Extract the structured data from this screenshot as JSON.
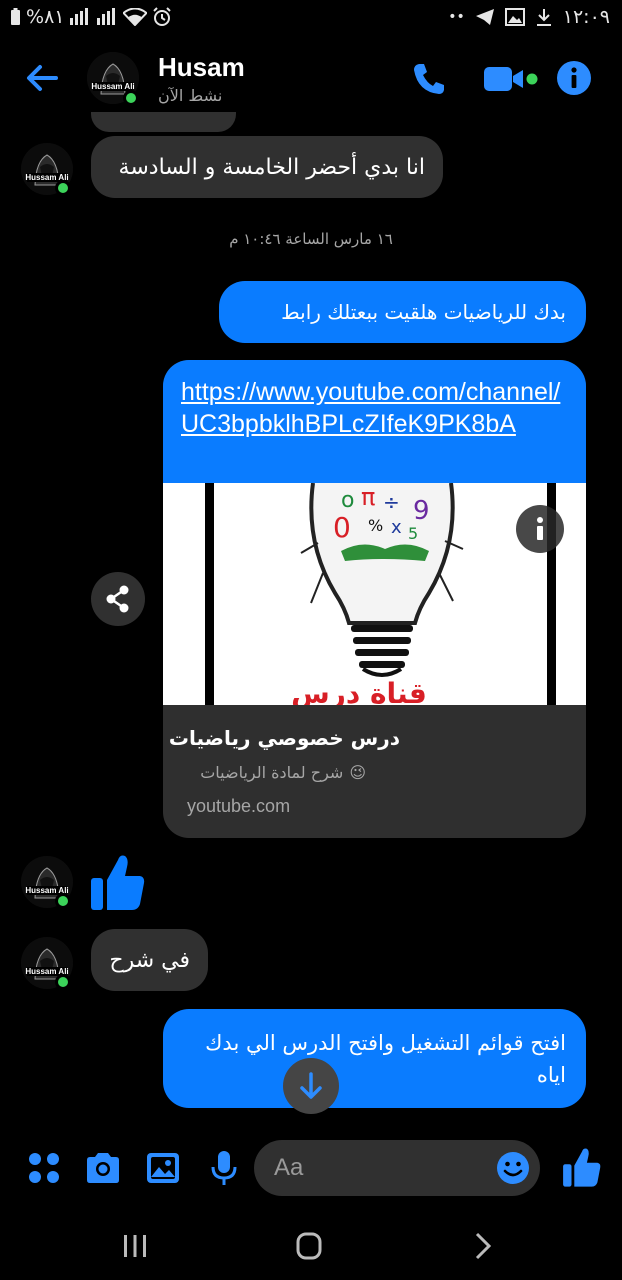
{
  "status_bar": {
    "battery_text": "%٨١",
    "time": "١٢:٠٩",
    "dots": "••"
  },
  "header": {
    "contact_name": "Husam",
    "contact_status": "نشط الآن",
    "avatar_label": "Hussam Ali"
  },
  "messages": {
    "incoming_1": "انا بدي أحضر الخامسة و السادسة",
    "timestamp": "١٦ مارس الساعة ١٠:٤٦ م",
    "outgoing_1": "بدك للرياضيات هلقيت ببعتلك رابط",
    "link_url": "https://www.youtube.com/channel/UC3bpbklhBPLcZIfeK9PK8bA",
    "link_title": "درس خصوصي رياضيات",
    "link_desc": "شرح لمادة الرياضيات",
    "link_desc_emoji": "😉",
    "link_domain": "youtube.com",
    "image_caption": "قناة درس",
    "incoming_2": "في شرح",
    "outgoing_2": "افتح قوائم التشغيل وافتح الدرس الي بدك اياه"
  },
  "composer": {
    "placeholder": "Aa"
  },
  "colors": {
    "accent": "#0a7cff",
    "online": "#3cd35a",
    "incoming_bubble": "#303030",
    "background": "#000000"
  },
  "icons": {
    "back": "back-arrow-icon",
    "call": "phone-icon",
    "video": "video-camera-icon",
    "info": "info-icon",
    "share": "share-icon",
    "thumb": "thumbs-up-icon",
    "scroll_down": "arrow-down-icon",
    "menu": "four-dots-icon",
    "camera": "camera-icon",
    "gallery": "image-icon",
    "mic": "microphone-icon",
    "emoji": "smiley-icon",
    "like": "thumbs-up-icon"
  }
}
